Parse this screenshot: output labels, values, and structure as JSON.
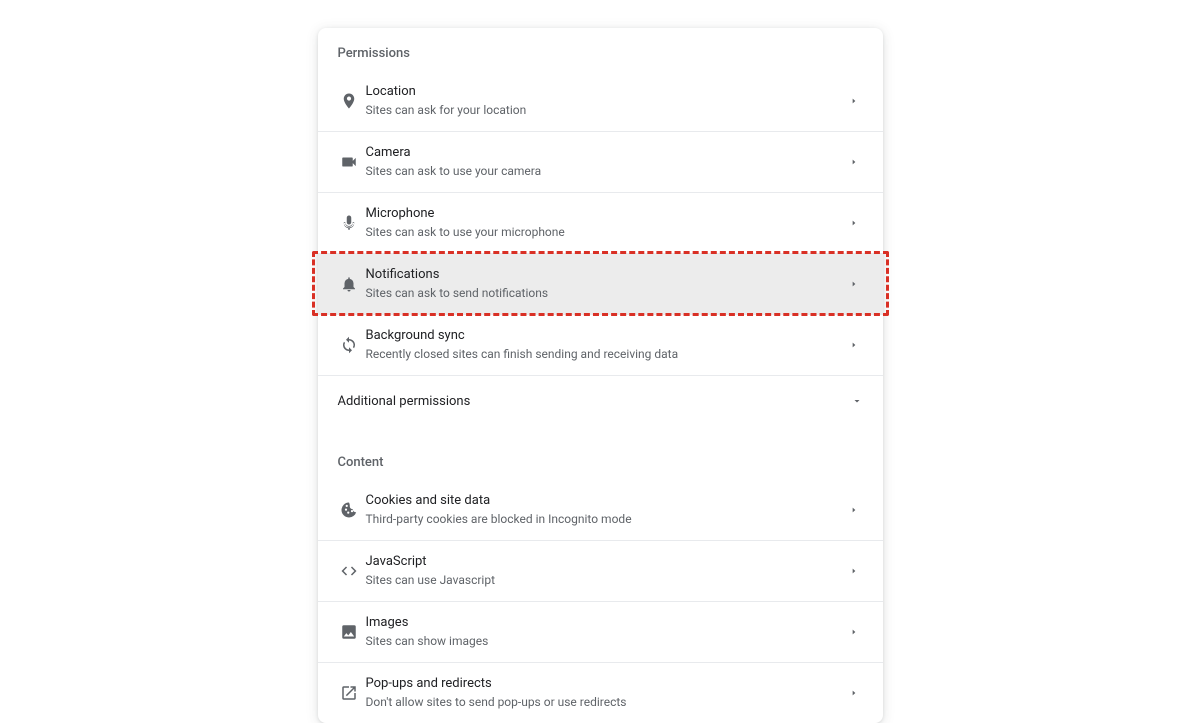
{
  "sections": {
    "permissions": {
      "header": "Permissions",
      "items": [
        {
          "key": "location",
          "title": "Location",
          "subtitle": "Sites can ask for your location"
        },
        {
          "key": "camera",
          "title": "Camera",
          "subtitle": "Sites can ask to use your camera"
        },
        {
          "key": "microphone",
          "title": "Microphone",
          "subtitle": "Sites can ask to use your microphone"
        },
        {
          "key": "notifications",
          "title": "Notifications",
          "subtitle": "Sites can ask to send notifications"
        },
        {
          "key": "background-sync",
          "title": "Background sync",
          "subtitle": "Recently closed sites can finish sending and receiving data"
        }
      ],
      "additional_label": "Additional permissions"
    },
    "content": {
      "header": "Content",
      "items": [
        {
          "key": "cookies",
          "title": "Cookies and site data",
          "subtitle": "Third-party cookies are blocked in Incognito mode"
        },
        {
          "key": "javascript",
          "title": "JavaScript",
          "subtitle": "Sites can use Javascript"
        },
        {
          "key": "images",
          "title": "Images",
          "subtitle": "Sites can show images"
        },
        {
          "key": "popups",
          "title": "Pop-ups and redirects",
          "subtitle": "Don't allow sites to send pop-ups or use redirects"
        }
      ]
    }
  },
  "highlighted_item": "notifications"
}
